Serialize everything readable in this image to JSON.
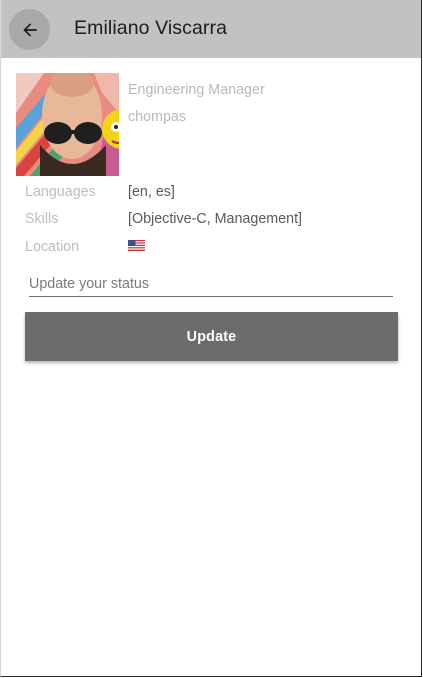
{
  "header": {
    "title": "Emiliano Viscarra",
    "back_icon": "arrow-back-icon"
  },
  "profile": {
    "avatar_icon": "profile-photo",
    "job_title": "Engineering Manager",
    "nickname": "chompas"
  },
  "details": {
    "languages_label": "Languages",
    "languages_value": "[en, es]",
    "skills_label": "Skills",
    "skills_value": "[Objective-C, Management]",
    "location_label": "Location",
    "location_icon": "us-flag-icon"
  },
  "status": {
    "placeholder": "Update your status",
    "value": ""
  },
  "actions": {
    "update_label": "Update"
  },
  "colors": {
    "appbar": "#c2c2c2",
    "button": "#6c6c6c",
    "label": "#bdbdbd",
    "value": "#5a5a5a"
  }
}
